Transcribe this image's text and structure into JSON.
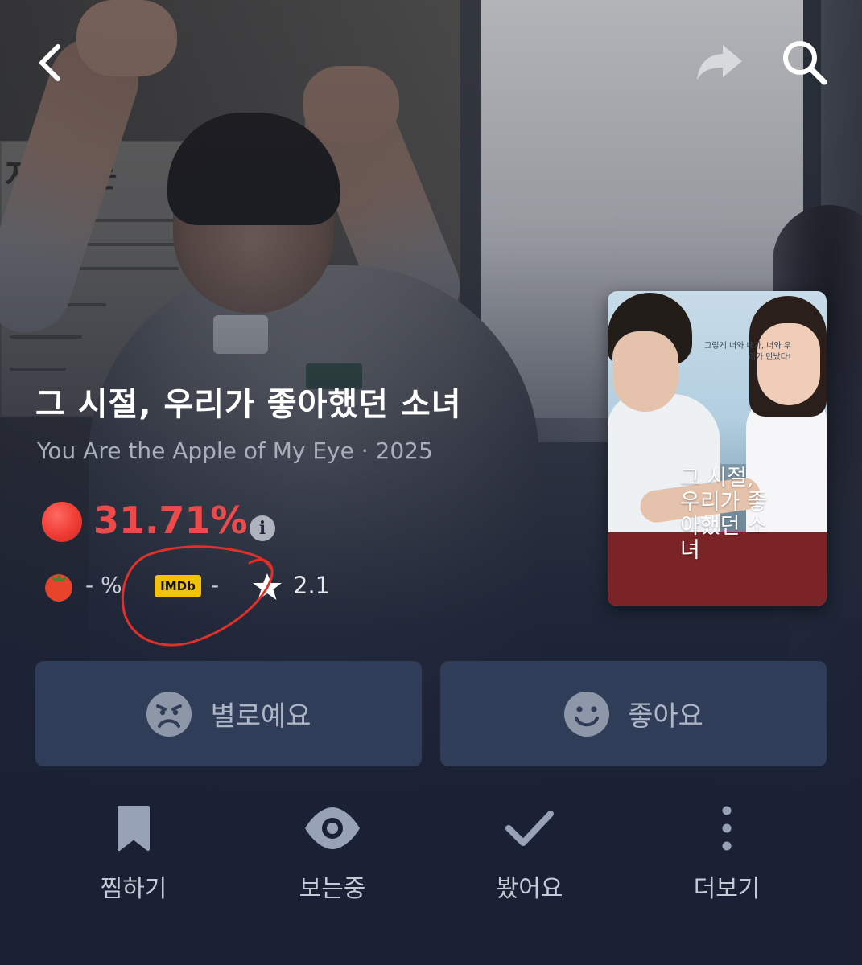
{
  "header": {
    "back_icon": "chevron-left-icon",
    "share_icon": "share-arrow-icon",
    "search_icon": "search-icon"
  },
  "backdrop": {
    "sign_title": "지 문"
  },
  "poster": {
    "tagline": "그렇게 너와 내가, 너와 우리가 만났다!",
    "title": "그 시절, 우리가 좋아했던 소녀"
  },
  "movie": {
    "title": "그 시절, 우리가 좋아했던 소녀",
    "subtitle": "You Are the Apple of My Eye · 2025"
  },
  "score": {
    "value": "31.71%",
    "color": "#ef4a4a",
    "info_icon": "info-icon"
  },
  "ratings": {
    "tomato_icon": "tomato-icon",
    "tomato_value": "- %",
    "imdb_label": "IMDb",
    "imdb_value": "-",
    "star_icon": "star-icon",
    "star_value": "2.1",
    "annotation_color": "#e0302a"
  },
  "rate_buttons": {
    "dislike_label": "별로예요",
    "like_label": "좋아요"
  },
  "actions": [
    {
      "label": "찜하기",
      "icon": "bookmark-icon"
    },
    {
      "label": "보는중",
      "icon": "eye-icon"
    },
    {
      "label": "봤어요",
      "icon": "check-icon"
    },
    {
      "label": "더보기",
      "icon": "more-vertical-icon"
    }
  ],
  "colors": {
    "background": "#1a2134",
    "button": "#2f3d58",
    "imdb": "#f2c20a"
  }
}
